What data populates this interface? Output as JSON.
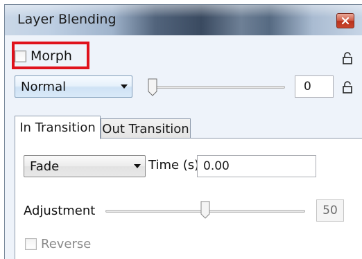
{
  "window": {
    "title": "Layer Blending",
    "close_icon": "close-icon"
  },
  "morph": {
    "label": "Morph",
    "checked": false,
    "highlight_color": "#e0121c"
  },
  "blend": {
    "mode_selected": "Normal",
    "opacity_value": "0",
    "opacity_slider_fraction": 0.0
  },
  "tabs": [
    {
      "label": "In Transition",
      "active": true
    },
    {
      "label": "Out Transition",
      "active": false
    }
  ],
  "transition": {
    "type_selected": "Fade",
    "time_label": "Time (s)",
    "time_value": "0.00",
    "adjustment_label": "Adjustment",
    "adjustment_value": "50",
    "adjustment_fraction": 0.5,
    "reverse_label": "Reverse",
    "reverse_checked": false
  },
  "icons": {
    "lock_top": "lock-icon",
    "lock_opacity": "lock-icon"
  }
}
